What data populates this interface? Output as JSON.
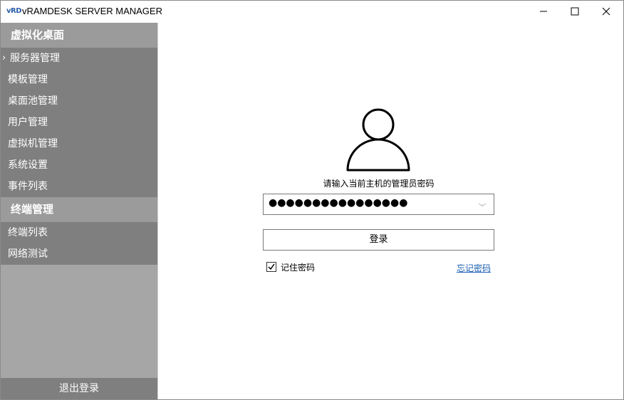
{
  "window": {
    "logo_text": "vRD",
    "title": "vRAMDESK SERVER MANAGER"
  },
  "sidebar": {
    "sections": [
      {
        "header": "虚拟化桌面",
        "items": [
          {
            "label": "服务器管理",
            "active": true
          },
          {
            "label": "模板管理"
          },
          {
            "label": "桌面池管理"
          },
          {
            "label": "用户管理"
          },
          {
            "label": "虚拟机管理"
          },
          {
            "label": "系统设置"
          },
          {
            "label": "事件列表"
          }
        ]
      },
      {
        "header": "终端管理",
        "items": [
          {
            "label": "终端列表"
          },
          {
            "label": "网络测试"
          }
        ]
      }
    ],
    "logout_label": "退出登录"
  },
  "login": {
    "prompt": "请输入当前主机的管理员密码",
    "password_masked": "●●●●●●●●●●●●●●●●",
    "login_label": "登录",
    "remember_label": "记住密码",
    "remember_checked": true,
    "forgot_label": "忘记密码"
  },
  "colors": {
    "sidebar_bg": "#a6a6a6",
    "sidebar_group_bg": "#7f7f7f",
    "link": "#1a5fb4"
  }
}
